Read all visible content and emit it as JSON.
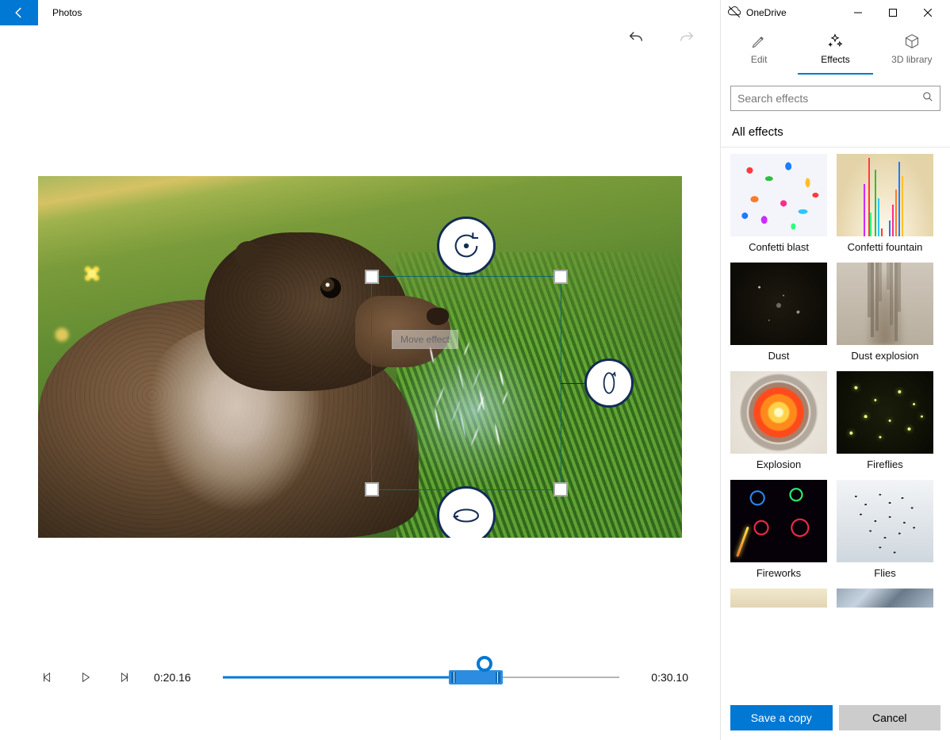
{
  "app": {
    "title": "Photos"
  },
  "video": {
    "tooltip": "Move effect",
    "current_time": "0:20.16",
    "duration": "0:30.10"
  },
  "sidebar": {
    "cloud_label": "OneDrive",
    "tabs": {
      "edit": "Edit",
      "effects": "Effects",
      "library3d": "3D library"
    },
    "search_placeholder": "Search effects",
    "section_title": "All effects",
    "effects": [
      {
        "id": "confetti-blast",
        "label": "Confetti blast",
        "thumb": "thumb-confetti-blast"
      },
      {
        "id": "confetti-fountain",
        "label": "Confetti fountain",
        "thumb": "thumb-confetti-fountain"
      },
      {
        "id": "dust",
        "label": "Dust",
        "thumb": "thumb-dust"
      },
      {
        "id": "dust-explosion",
        "label": "Dust explosion",
        "thumb": "thumb-dust-exp"
      },
      {
        "id": "explosion",
        "label": "Explosion",
        "thumb": "thumb-explosion"
      },
      {
        "id": "fireflies",
        "label": "Fireflies",
        "thumb": "thumb-fireflies"
      },
      {
        "id": "fireworks",
        "label": "Fireworks",
        "thumb": "thumb-fireworks"
      },
      {
        "id": "flies",
        "label": "Flies",
        "thumb": "thumb-flies"
      }
    ],
    "effects_slice": [
      {
        "id": "slice-1",
        "thumb": "thumb-slice1"
      },
      {
        "id": "slice-2",
        "thumb": "thumb-slice2"
      }
    ],
    "buttons": {
      "save": "Save a copy",
      "cancel": "Cancel"
    }
  }
}
